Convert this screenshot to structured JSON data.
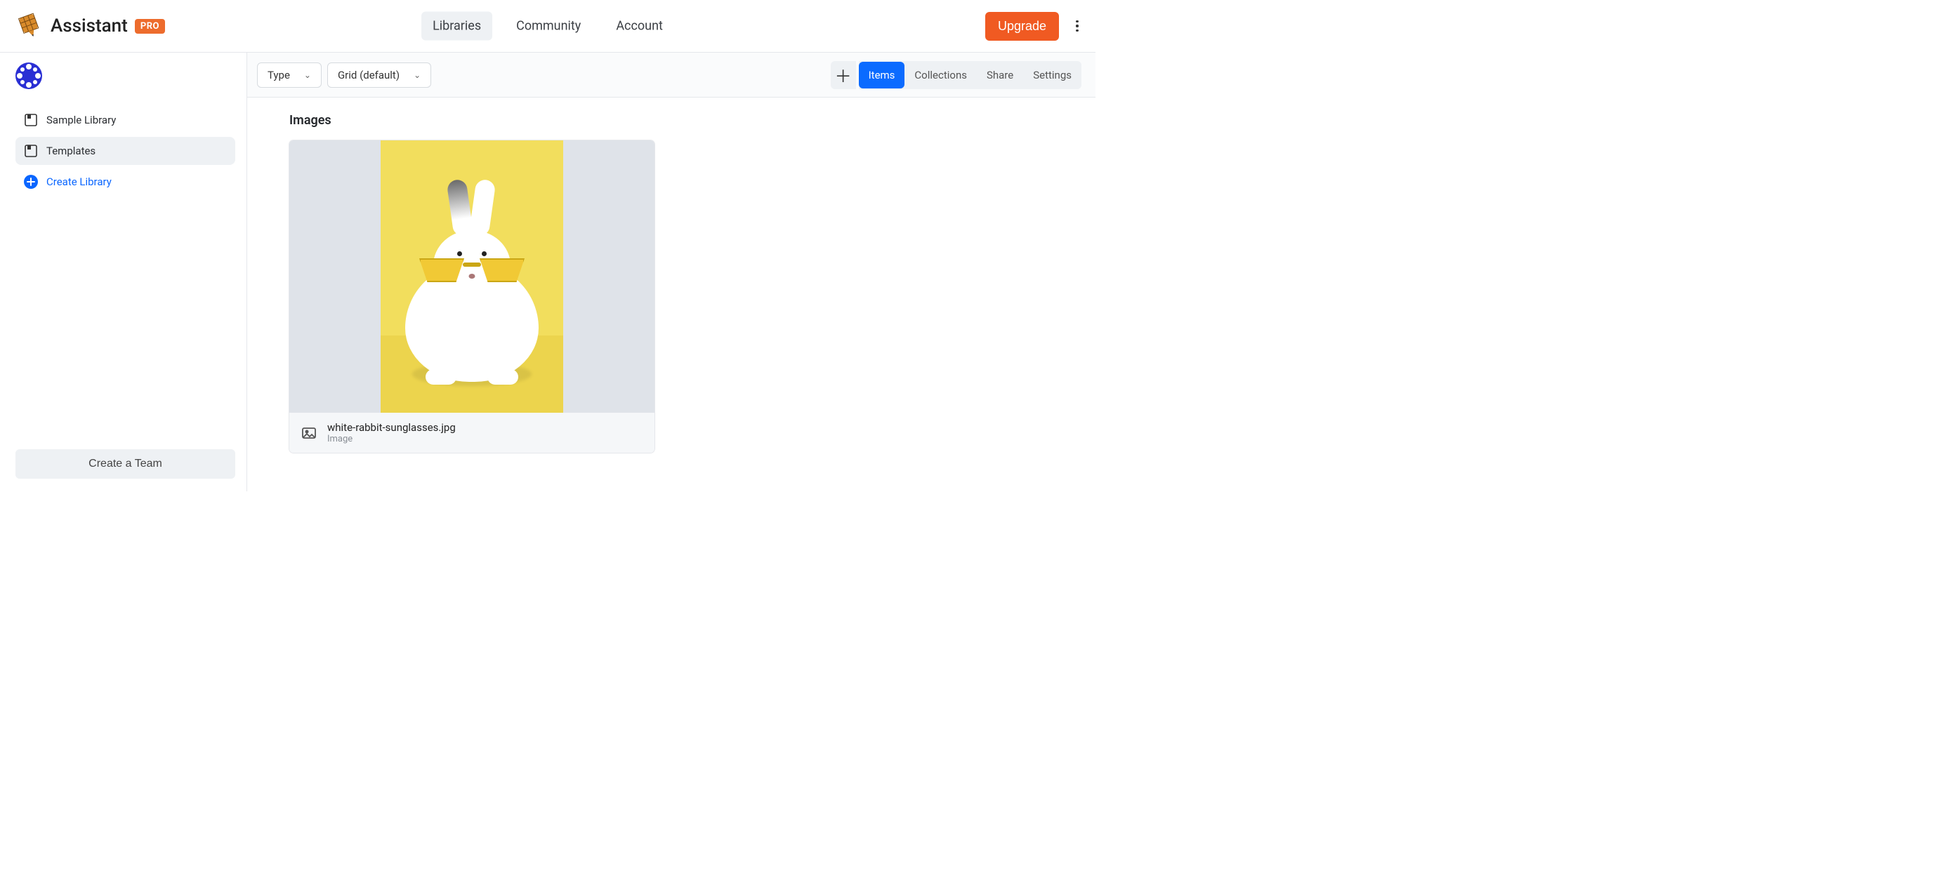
{
  "header": {
    "brand_name": "Assistant",
    "pro_badge": "PRO",
    "nav": [
      {
        "label": "Libraries",
        "active": true
      },
      {
        "label": "Community",
        "active": false
      },
      {
        "label": "Account",
        "active": false
      }
    ],
    "upgrade_label": "Upgrade"
  },
  "sidebar": {
    "libraries": [
      {
        "label": "Sample Library",
        "active": false
      },
      {
        "label": "Templates",
        "active": true
      }
    ],
    "create_library_label": "Create Library",
    "create_team_label": "Create a Team"
  },
  "toolbar": {
    "type_label": "Type",
    "view_label": "Grid (default)",
    "tabs": [
      {
        "label": "Items",
        "active": true
      },
      {
        "label": "Collections",
        "active": false
      },
      {
        "label": "Share",
        "active": false
      },
      {
        "label": "Settings",
        "active": false
      }
    ]
  },
  "content": {
    "section_title": "Images",
    "items": [
      {
        "filename": "white-rabbit-sunglasses.jpg",
        "type_label": "Image"
      }
    ]
  },
  "colors": {
    "accent_orange": "#f05a22",
    "accent_blue": "#0b6bff"
  }
}
